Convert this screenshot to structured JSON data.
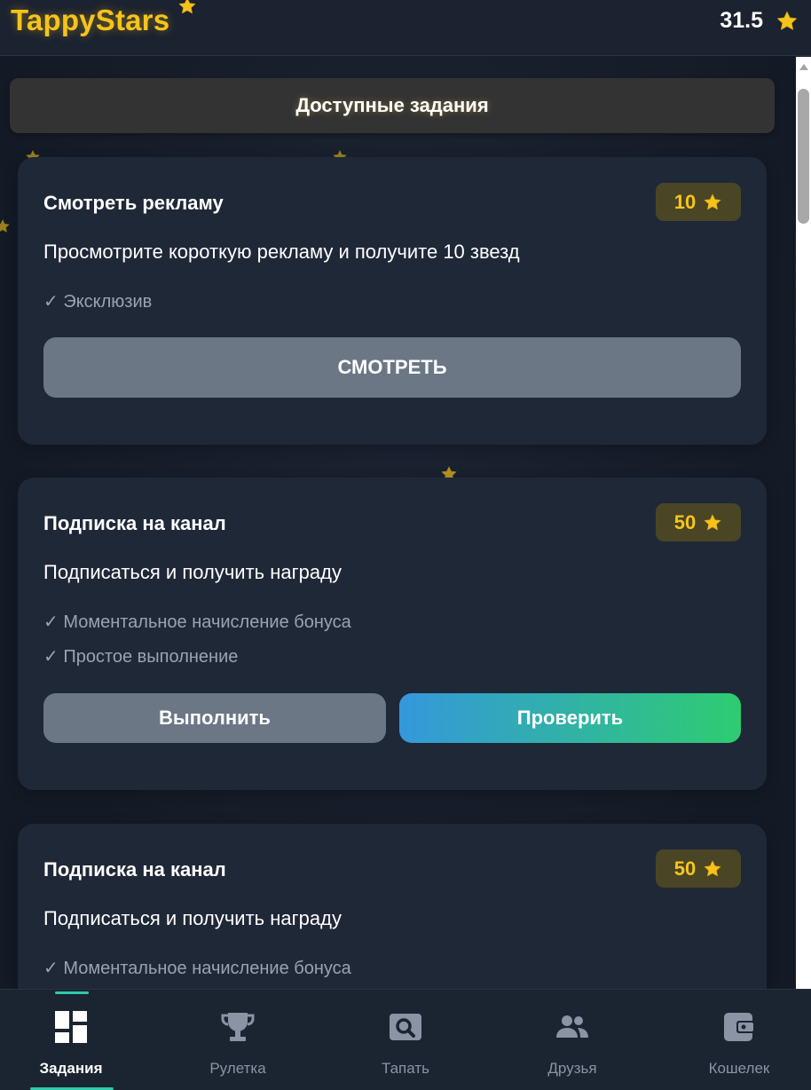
{
  "app": {
    "title": "TappyStars",
    "balance": "31.5"
  },
  "section": {
    "title": "Доступные задания"
  },
  "tasks": [
    {
      "title": "Смотреть рекламу",
      "reward": "10",
      "description": "Просмотрите короткую рекламу и получите 10 звезд",
      "features": [
        "✓ Эксклюзив"
      ],
      "buttons": [
        "СМОТРЕТЬ"
      ]
    },
    {
      "title": "Подписка на канал",
      "reward": "50",
      "description": "Подписаться и получить награду",
      "features": [
        "✓ Моментальное начисление бонуса",
        "✓ Простое выполнение"
      ],
      "buttons": [
        "Выполнить",
        "Проверить"
      ]
    },
    {
      "title": "Подписка на канал",
      "reward": "50",
      "description": "Подписаться и получить награду",
      "features": [
        "✓ Моментальное начисление бонуса"
      ],
      "buttons": []
    }
  ],
  "nav": {
    "items": [
      {
        "label": "Задания",
        "icon": "dashboard-icon",
        "active": true
      },
      {
        "label": "Рулетка",
        "icon": "trophy-icon",
        "active": false
      },
      {
        "label": "Тапать",
        "icon": "search-icon",
        "active": false
      },
      {
        "label": "Друзья",
        "icon": "people-icon",
        "active": false
      },
      {
        "label": "Кошелек",
        "icon": "wallet-icon",
        "active": false
      }
    ]
  },
  "colors": {
    "accent": "#f7c61c",
    "active_tab": "#2dc9a8",
    "gradient_start": "#3498db",
    "gradient_end": "#2ecc71",
    "card_bg": "#1f2837"
  }
}
